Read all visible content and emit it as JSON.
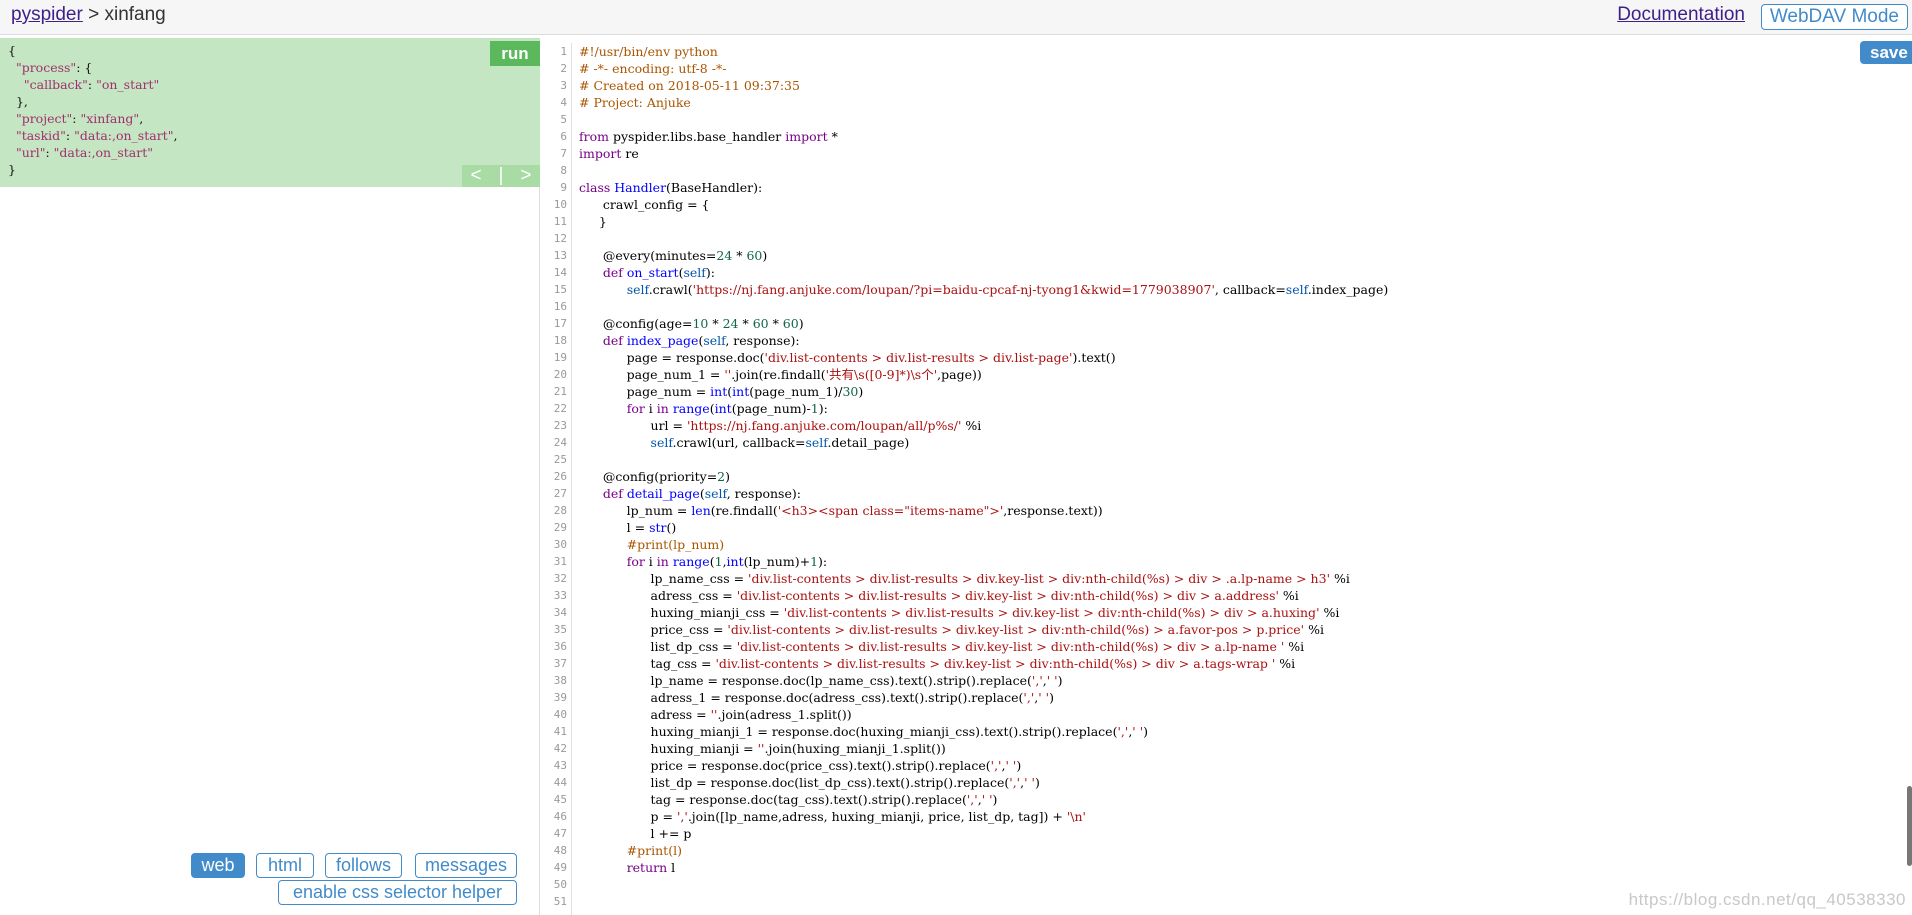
{
  "breadcrumb": {
    "link": "pyspider",
    "separator": " > ",
    "project": "xinfang"
  },
  "header": {
    "documentation": "Documentation",
    "webdav": "WebDAV Mode"
  },
  "task": {
    "json_lines": [
      [
        [
          "p",
          "{"
        ]
      ],
      [
        [
          "p",
          "  "
        ],
        [
          "k",
          "\"process\""
        ],
        [
          "p",
          ": {"
        ]
      ],
      [
        [
          "p",
          "    "
        ],
        [
          "k",
          "\"callback\""
        ],
        [
          "p",
          ": "
        ],
        [
          "v",
          "\"on_start\""
        ]
      ],
      [
        [
          "p",
          "  },"
        ]
      ],
      [
        [
          "p",
          "  "
        ],
        [
          "k",
          "\"project\""
        ],
        [
          "p",
          ": "
        ],
        [
          "v",
          "\"xinfang\""
        ],
        [
          "p",
          ","
        ]
      ],
      [
        [
          "p",
          "  "
        ],
        [
          "k",
          "\"taskid\""
        ],
        [
          "p",
          ": "
        ],
        [
          "v",
          "\"data:,on_start\""
        ],
        [
          "p",
          ","
        ]
      ],
      [
        [
          "p",
          "  "
        ],
        [
          "k",
          "\"url\""
        ],
        [
          "p",
          ": "
        ],
        [
          "v",
          "\"data:,on_start\""
        ]
      ],
      [
        [
          "p",
          "}"
        ]
      ]
    ],
    "run": "run",
    "prev": "<",
    "next": ">"
  },
  "tabs": {
    "web": "web",
    "html": "html",
    "follows": "follows",
    "messages": "messages",
    "css_helper": "enable css selector helper"
  },
  "editor": {
    "save": "save"
  },
  "code_colors": {
    "c": "#aa5500",
    "k": "#770088",
    "d": "#0000ff",
    "s": "#aa1111",
    "n": "#116644",
    "v": "#0055aa",
    "p": "#000000"
  },
  "code_lines": [
    [
      [
        "c",
        "#!/usr/bin/env python"
      ]
    ],
    [
      [
        "c",
        "# -*- encoding: utf-8 -*-"
      ]
    ],
    [
      [
        "c",
        "# Created on 2018-05-11 09:37:35"
      ]
    ],
    [
      [
        "c",
        "# Project: Anjuke"
      ]
    ],
    [],
    [
      [
        "k",
        "from"
      ],
      [
        "p",
        " pyspider.libs.base_handler "
      ],
      [
        "k",
        "import"
      ],
      [
        "p",
        " *"
      ]
    ],
    [
      [
        "k",
        "import"
      ],
      [
        "p",
        " re"
      ]
    ],
    [],
    [
      [
        "k",
        "class"
      ],
      [
        "p",
        " "
      ],
      [
        "d",
        "Handler"
      ],
      [
        "p",
        "(BaseHandler):"
      ]
    ],
    [
      [
        "p",
        "      crawl_config = {"
      ]
    ],
    [
      [
        "p",
        "     }"
      ]
    ],
    [],
    [
      [
        "p",
        "      @every(minutes="
      ],
      [
        "n",
        "24"
      ],
      [
        "p",
        " * "
      ],
      [
        "n",
        "60"
      ],
      [
        "p",
        ")"
      ]
    ],
    [
      [
        "p",
        "      "
      ],
      [
        "k",
        "def"
      ],
      [
        "p",
        " "
      ],
      [
        "d",
        "on_start"
      ],
      [
        "p",
        "("
      ],
      [
        "v",
        "self"
      ],
      [
        "p",
        "):"
      ]
    ],
    [
      [
        "p",
        "            "
      ],
      [
        "v",
        "self"
      ],
      [
        "p",
        ".crawl("
      ],
      [
        "s",
        "'https://nj.fang.anjuke.com/loupan/?pi=baidu-cpcaf-nj-tyong1&kwid=1779038907'"
      ],
      [
        "p",
        ", callback="
      ],
      [
        "v",
        "self"
      ],
      [
        "p",
        ".index_page)"
      ]
    ],
    [],
    [
      [
        "p",
        "      @config(age="
      ],
      [
        "n",
        "10"
      ],
      [
        "p",
        " * "
      ],
      [
        "n",
        "24"
      ],
      [
        "p",
        " * "
      ],
      [
        "n",
        "60"
      ],
      [
        "p",
        " * "
      ],
      [
        "n",
        "60"
      ],
      [
        "p",
        ")"
      ]
    ],
    [
      [
        "p",
        "      "
      ],
      [
        "k",
        "def"
      ],
      [
        "p",
        " "
      ],
      [
        "d",
        "index_page"
      ],
      [
        "p",
        "("
      ],
      [
        "v",
        "self"
      ],
      [
        "p",
        ", response):"
      ]
    ],
    [
      [
        "p",
        "            page = response.doc("
      ],
      [
        "s",
        "'div.list-contents > div.list-results > div.list-page'"
      ],
      [
        "p",
        ").text()"
      ]
    ],
    [
      [
        "p",
        "            page_num_1 = "
      ],
      [
        "s",
        "''"
      ],
      [
        "p",
        ".join(re.findall("
      ],
      [
        "s",
        "'共有\\s([0-9]*)\\s个'"
      ],
      [
        "p",
        ",page))"
      ]
    ],
    [
      [
        "p",
        "            page_num = "
      ],
      [
        "d",
        "int"
      ],
      [
        "p",
        "("
      ],
      [
        "d",
        "int"
      ],
      [
        "p",
        "(page_num_1)/"
      ],
      [
        "n",
        "30"
      ],
      [
        "p",
        ")"
      ]
    ],
    [
      [
        "p",
        "            "
      ],
      [
        "k",
        "for"
      ],
      [
        "p",
        " i "
      ],
      [
        "k",
        "in"
      ],
      [
        "p",
        " "
      ],
      [
        "d",
        "range"
      ],
      [
        "p",
        "("
      ],
      [
        "d",
        "int"
      ],
      [
        "p",
        "(page_num)-"
      ],
      [
        "n",
        "1"
      ],
      [
        "p",
        "):"
      ]
    ],
    [
      [
        "p",
        "                  url = "
      ],
      [
        "s",
        "'https://nj.fang.anjuke.com/loupan/all/p%s/'"
      ],
      [
        "p",
        " %i"
      ]
    ],
    [
      [
        "p",
        "                  "
      ],
      [
        "v",
        "self"
      ],
      [
        "p",
        ".crawl(url, callback="
      ],
      [
        "v",
        "self"
      ],
      [
        "p",
        ".detail_page)"
      ]
    ],
    [],
    [
      [
        "p",
        "      @config(priority="
      ],
      [
        "n",
        "2"
      ],
      [
        "p",
        ")"
      ]
    ],
    [
      [
        "p",
        "      "
      ],
      [
        "k",
        "def"
      ],
      [
        "p",
        " "
      ],
      [
        "d",
        "detail_page"
      ],
      [
        "p",
        "("
      ],
      [
        "v",
        "self"
      ],
      [
        "p",
        ", response):"
      ]
    ],
    [
      [
        "p",
        "            lp_num = "
      ],
      [
        "d",
        "len"
      ],
      [
        "p",
        "(re.findall("
      ],
      [
        "s",
        "'<h3><span class=\"items-name\">'"
      ],
      [
        "p",
        ",response.text))"
      ]
    ],
    [
      [
        "p",
        "            l = "
      ],
      [
        "d",
        "str"
      ],
      [
        "p",
        "()"
      ]
    ],
    [
      [
        "p",
        "            "
      ],
      [
        "c",
        "#print(lp_num)"
      ]
    ],
    [
      [
        "p",
        "            "
      ],
      [
        "k",
        "for"
      ],
      [
        "p",
        " i "
      ],
      [
        "k",
        "in"
      ],
      [
        "p",
        " "
      ],
      [
        "d",
        "range"
      ],
      [
        "p",
        "("
      ],
      [
        "n",
        "1"
      ],
      [
        "p",
        ","
      ],
      [
        "d",
        "int"
      ],
      [
        "p",
        "(lp_num)+"
      ],
      [
        "n",
        "1"
      ],
      [
        "p",
        "):"
      ]
    ],
    [
      [
        "p",
        "                  lp_name_css = "
      ],
      [
        "s",
        "'div.list-contents > div.list-results > div.key-list > div:nth-child(%s) > div > .a.lp-name > h3'"
      ],
      [
        "p",
        " %i"
      ]
    ],
    [
      [
        "p",
        "                  adress_css = "
      ],
      [
        "s",
        "'div.list-contents > div.list-results > div.key-list > div:nth-child(%s) > div > a.address'"
      ],
      [
        "p",
        " %i"
      ]
    ],
    [
      [
        "p",
        "                  huxing_mianji_css = "
      ],
      [
        "s",
        "'div.list-contents > div.list-results > div.key-list > div:nth-child(%s) > div > a.huxing'"
      ],
      [
        "p",
        " %i"
      ]
    ],
    [
      [
        "p",
        "                  price_css = "
      ],
      [
        "s",
        "'div.list-contents > div.list-results > div.key-list > div:nth-child(%s) > a.favor-pos > p.price'"
      ],
      [
        "p",
        " %i"
      ]
    ],
    [
      [
        "p",
        "                  list_dp_css = "
      ],
      [
        "s",
        "'div.list-contents > div.list-results > div.key-list > div:nth-child(%s) > div > a.lp-name '"
      ],
      [
        "p",
        " %i"
      ]
    ],
    [
      [
        "p",
        "                  tag_css = "
      ],
      [
        "s",
        "'div.list-contents > div.list-results > div.key-list > div:nth-child(%s) > div > a.tags-wrap '"
      ],
      [
        "p",
        " %i"
      ]
    ],
    [
      [
        "p",
        "                  lp_name = response.doc(lp_name_css).text().strip().replace("
      ],
      [
        "s",
        "','"
      ],
      [
        "p",
        ","
      ],
      [
        "s",
        "' '"
      ],
      [
        "p",
        ")"
      ]
    ],
    [
      [
        "p",
        "                  adress_1 = response.doc(adress_css).text().strip().replace("
      ],
      [
        "s",
        "','"
      ],
      [
        "p",
        ","
      ],
      [
        "s",
        "' '"
      ],
      [
        "p",
        ")"
      ]
    ],
    [
      [
        "p",
        "                  adress = "
      ],
      [
        "s",
        "''"
      ],
      [
        "p",
        ".join(adress_1.split())"
      ]
    ],
    [
      [
        "p",
        "                  huxing_mianji_1 = response.doc(huxing_mianji_css).text().strip().replace("
      ],
      [
        "s",
        "','"
      ],
      [
        "p",
        ","
      ],
      [
        "s",
        "' '"
      ],
      [
        "p",
        ")"
      ]
    ],
    [
      [
        "p",
        "                  huxing_mianji = "
      ],
      [
        "s",
        "''"
      ],
      [
        "p",
        ".join(huxing_mianji_1.split())"
      ]
    ],
    [
      [
        "p",
        "                  price = response.doc(price_css).text().strip().replace("
      ],
      [
        "s",
        "','"
      ],
      [
        "p",
        ","
      ],
      [
        "s",
        "' '"
      ],
      [
        "p",
        ")"
      ]
    ],
    [
      [
        "p",
        "                  list_dp = response.doc(list_dp_css).text().strip().replace("
      ],
      [
        "s",
        "','"
      ],
      [
        "p",
        ","
      ],
      [
        "s",
        "' '"
      ],
      [
        "p",
        ")"
      ]
    ],
    [
      [
        "p",
        "                  tag = response.doc(tag_css).text().strip().replace("
      ],
      [
        "s",
        "','"
      ],
      [
        "p",
        ","
      ],
      [
        "s",
        "' '"
      ],
      [
        "p",
        ")"
      ]
    ],
    [
      [
        "p",
        "                  p = "
      ],
      [
        "s",
        "','"
      ],
      [
        "p",
        ".join([lp_name,adress, huxing_mianji, price, list_dp, tag]) + "
      ],
      [
        "s",
        "'\\n'"
      ]
    ],
    [
      [
        "p",
        "                  l += p"
      ]
    ],
    [
      [
        "p",
        "            "
      ],
      [
        "c",
        "#print(l)"
      ]
    ],
    [
      [
        "p",
        "            "
      ],
      [
        "k",
        "return"
      ],
      [
        "p",
        " l"
      ]
    ],
    [],
    []
  ],
  "watermark": "https://blog.csdn.net/qq_40538330"
}
